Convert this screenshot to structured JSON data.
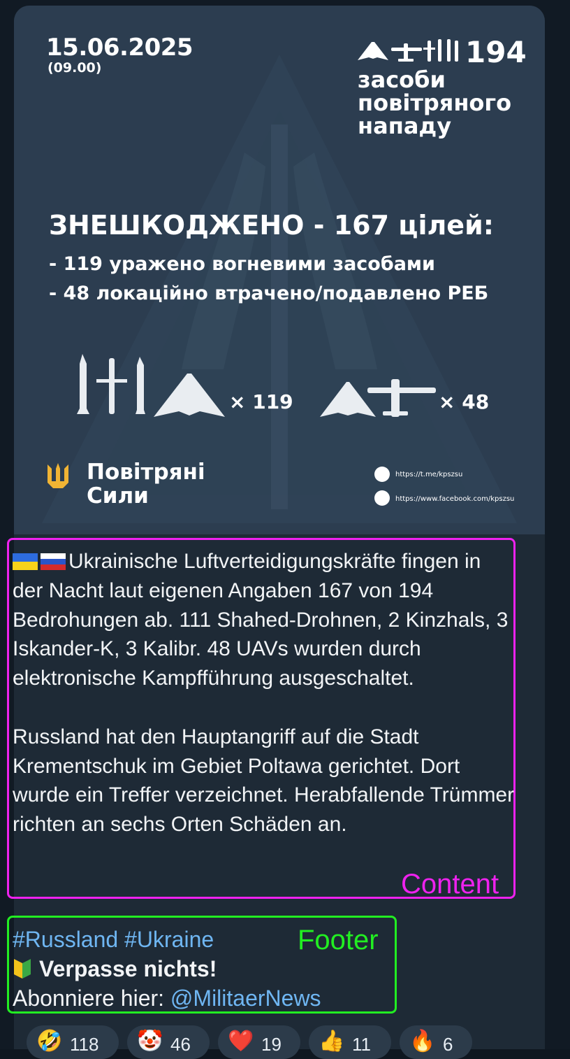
{
  "infographic": {
    "date": "15.06.2025",
    "time": "(09.00)",
    "total_count": "194",
    "total_label": "засоби повітряного нападу",
    "headline": "ЗНЕШКОДЖЕНО - 167 цілей:",
    "line1": "- 119 уражено вогневими засобами",
    "line2": "- 48 локаційно втрачено/подавлено РЕБ",
    "multiplier_1": "× 119",
    "multiplier_2": "× 48",
    "org_line1": "Повітряні",
    "org_line2": "Сили",
    "telegram_url": "https://t.me/kpszsu",
    "facebook_url": "https://www.facebook.com/kpszsu",
    "icons": [
      "trident-icon",
      "missile-icon",
      "cruise-missile-icon",
      "shahed-drone-icon",
      "uav-plane-icon",
      "telegram-icon",
      "facebook-icon"
    ]
  },
  "message": {
    "flags": [
      "ukraine-flag",
      "russia-flag"
    ],
    "paragraph1": "Ukrainische Luftverteidigungskräfte fingen in der Nacht laut eigenen Angaben 167 von 194 Bedrohungen ab. 111 Shahed-Drohnen, 2 Kinzhals, 3 Iskander-K, 3 Kalibr. 48 UAVs wurden durch elektronische Kampfführung ausgeschaltet.",
    "paragraph2": "Russland hat den Hauptangriff auf die Stadt Krementschuk im Gebiet Poltawa gerichtet. Dort wurde ein Treffer verzeichnet. Herabfallende Trümmer richten an sechs Orten Schäden an."
  },
  "footer": {
    "hashtags": "#Russland #Ukraine",
    "cta": "Verpasse nichts!",
    "subscribe_prefix": "Abonniere hier: ",
    "handle": "@MilitaerNews"
  },
  "annotations": {
    "content_label": "Content",
    "footer_label": "Footer",
    "content_color": "#ee22ee",
    "footer_color": "#22ee22"
  },
  "reactions": [
    {
      "emoji": "🤣",
      "count": "118"
    },
    {
      "emoji": "🤡",
      "count": "46"
    },
    {
      "emoji": "❤️",
      "count": "19"
    },
    {
      "emoji": "👍",
      "count": "11"
    },
    {
      "emoji": "🔥",
      "count": "6"
    }
  ]
}
